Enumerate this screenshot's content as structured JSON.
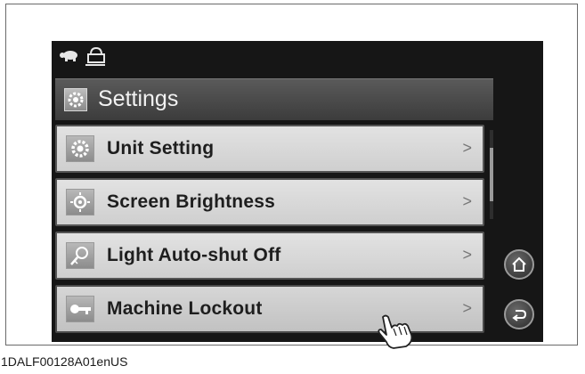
{
  "header": {
    "title": "Settings",
    "icon": "gear-icon"
  },
  "status_bar": {
    "icons": [
      "turtle-icon",
      "machine-lock-icon"
    ]
  },
  "menu": {
    "items": [
      {
        "label": "Unit Setting",
        "icon": "gear-icon",
        "chevron": ">"
      },
      {
        "label": "Screen Brightness",
        "icon": "brightness-icon",
        "chevron": ">"
      },
      {
        "label": "Light Auto-shut Off",
        "icon": "light-auto-off-icon",
        "chevron": ">"
      },
      {
        "label": "Machine Lockout",
        "icon": "key-icon",
        "chevron": ">",
        "selected": true
      }
    ]
  },
  "side_buttons": {
    "home": "home-icon",
    "back": "back-icon"
  },
  "caption": "1DALF00128A01enUS",
  "colors": {
    "screen_background": "#161616",
    "header_background": "#4a4a4a",
    "item_background": "#d9d9d9"
  }
}
